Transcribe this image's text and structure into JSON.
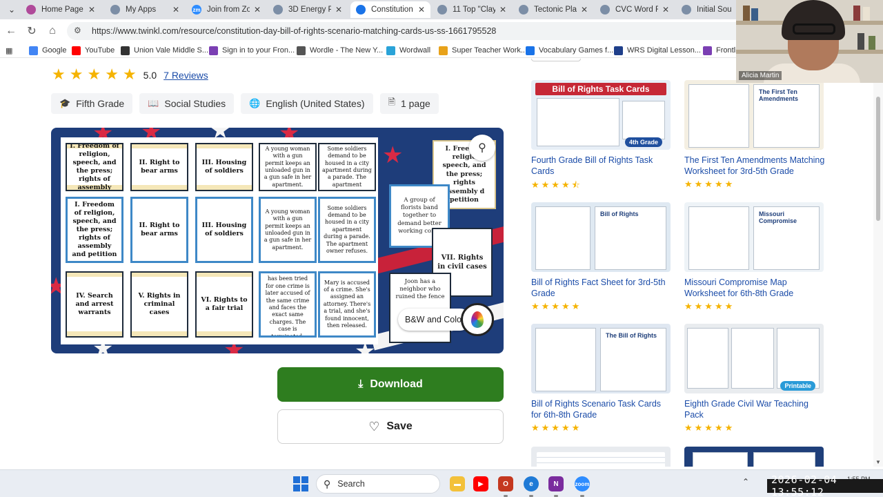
{
  "browser": {
    "tabs": [
      {
        "title": "Home Page - C",
        "favicon_color": "#b04a9a",
        "active": false
      },
      {
        "title": "My Apps",
        "favicon_color": "#7c8ea6",
        "active": false
      },
      {
        "title": "Join from Zoon",
        "favicon_color": "#2d8cff",
        "favicon_text": "zm",
        "active": false
      },
      {
        "title": "3D Energy Pyra",
        "favicon_color": "#7c8ea6",
        "active": false
      },
      {
        "title": "Constitution D",
        "favicon_color": "#1a73e8",
        "active": true
      },
      {
        "title": "11 Top \"Clay Pi",
        "favicon_color": "#7c8ea6",
        "active": false
      },
      {
        "title": "Tectonic Plate E",
        "favicon_color": "#7c8ea6",
        "active": false
      },
      {
        "title": "CVC Word Fran",
        "favicon_color": "#7c8ea6",
        "active": false
      },
      {
        "title": "Initial Sound",
        "favicon_color": "#7c8ea6",
        "active": false
      }
    ],
    "url": "https://www.twinkl.com/resource/constitution-day-bill-of-rights-scenario-matching-cards-us-ss-1661795528",
    "bookmarks": [
      {
        "label": "Google",
        "color": "#4285f4"
      },
      {
        "label": "YouTube",
        "color": "#ff0000"
      },
      {
        "label": "Union Vale Middle S...",
        "color": "#333333"
      },
      {
        "label": "Sign in to your Fron...",
        "color": "#7b3fb3"
      },
      {
        "label": "Wordle - The New Y...",
        "color": "#555555"
      },
      {
        "label": "Wordwall",
        "color": "#2aa3d8"
      },
      {
        "label": "Super Teacher Work...",
        "color": "#e8a21a"
      },
      {
        "label": "Vocabulary Games f...",
        "color": "#1a73e8"
      },
      {
        "label": "WRS Digital Lesson...",
        "color": "#1f3f8a"
      },
      {
        "label": "Frontli",
        "color": "#7b3fb3"
      }
    ]
  },
  "product": {
    "rating_value": "5.0",
    "rating_stars": 5,
    "reviews_label": "7 Reviews",
    "chips": [
      {
        "icon": "graduation-cap-icon",
        "glyph": "🎓",
        "label": "Fifth Grade"
      },
      {
        "icon": "book-icon",
        "glyph": "📖",
        "label": "Social Studies"
      },
      {
        "icon": "globe-icon",
        "glyph": "🌐",
        "label": "English (United States)"
      },
      {
        "icon": "page-icon",
        "glyph": "🗎",
        "label": "1 page"
      }
    ],
    "preview": {
      "cards": [
        "I. Freedom of religion, speech, and the press; rights of assembly",
        "II. Right to bear arms",
        "III. Housing of soldiers",
        "A young woman with a gun permit keeps an unloaded gun in a gun safe in her apartment.",
        "Some soldiers demand to be housed in a city apartment during a parade. The apartment",
        "I. Freedom of religion, speech, and the press; rights of assembly and petition",
        "II. Right to bear arms",
        "III. Housing of soldiers",
        "A young woman with a gun permit keeps an unloaded gun in a gun safe in her apartment.",
        "Some soldiers demand to be housed in a city apartment during a parade. The apartment owner refuses.",
        "IV. Search and arrest warrants",
        "V. Rights in criminal cases",
        "VI. Rights to a fair trial",
        "Someone who has been tried for one crime is later accused of the same crime and faces the exact same charges. The case is terminated.",
        "Mary is accused of a crime. She's assigned an attorney. There's a trial, and she's found innocent, then released."
      ],
      "loose_cards": [
        "I. Freed of religio speech, and the press; rights assembly d petition",
        "A group of florists band together to demand better working condi",
        "VII. Rights in civil cases",
        "Joon has a neighbor who ruined the fence"
      ],
      "bw_label": "B&W and Color"
    },
    "download_label": "Download",
    "save_label": "Save"
  },
  "related": [
    {
      "title": "Fourth Grade Bill of Rights Task Cards",
      "stars": "★★★★⯪",
      "banner": "Bill of Rights Task Cards",
      "badge": "4th Grade"
    },
    {
      "title": "The First Ten Amendments Matching Worksheet for 3rd-5th Grade",
      "stars": "★★★★★",
      "banner": "The First Ten Amendments",
      "badge": ""
    },
    {
      "title": "Bill of Rights Fact Sheet for 3rd-5th Grade",
      "stars": "★★★★★",
      "banner": "Bill of Rights",
      "badge": ""
    },
    {
      "title": "Missouri Compromise Map Worksheet for 6th-8th Grade",
      "stars": "★★★★★",
      "banner": "Missouri Compromise",
      "badge": ""
    },
    {
      "title": "Bill of Rights Scenario Task Cards for 6th-8th Grade",
      "stars": "★★★★★",
      "banner": "The Bill of Rights",
      "badge": ""
    },
    {
      "title": "Eighth Grade Civil War Teaching Pack",
      "stars": "★★★★★",
      "banner": "",
      "badge": "Printable"
    }
  ],
  "webcam": {
    "name": "Alicia Martin"
  },
  "taskbar": {
    "search_label": "Search",
    "clock_small": "1:55 PM",
    "timestamp": "2026-02-04  13:55:12"
  },
  "colors": {
    "brand_green": "#2e7d1f",
    "star": "#f5b301",
    "link": "#1b4ca8"
  }
}
